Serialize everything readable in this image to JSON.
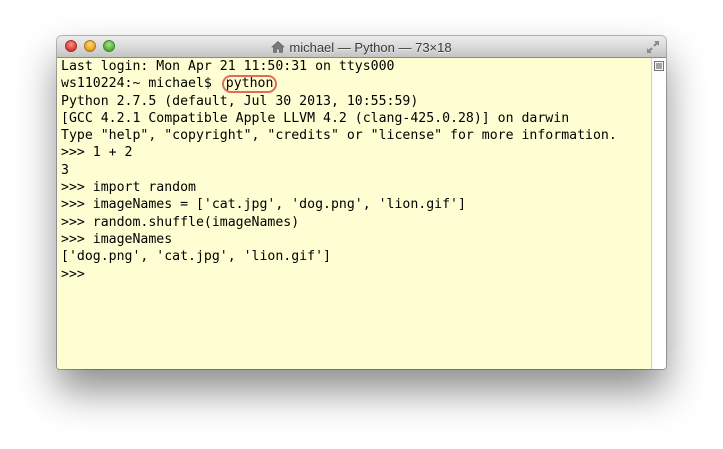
{
  "window": {
    "title": "michael — Python — 73×18",
    "title_icon": "home-icon",
    "traffic_lights": [
      "close",
      "minimize",
      "zoom"
    ],
    "colors": {
      "terminal_background": "#fefed2",
      "text": "#000000",
      "highlight_circle": "#e06b5a"
    }
  },
  "terminal": {
    "lines": [
      "Last login: Mon Apr 21 11:50:31 on ttys000",
      "ws110224:~ michael$ ",
      "Python 2.7.5 (default, Jul 30 2013, 10:55:59)",
      "[GCC 4.2.1 Compatible Apple LLVM 4.2 (clang-425.0.28)] on darwin",
      "Type \"help\", \"copyright\", \"credits\" or \"license\" for more information.",
      ">>> 1 + 2",
      "3",
      ">>> import random",
      ">>> imageNames = ['cat.jpg', 'dog.png', 'lion.gif']",
      ">>> random.shuffle(imageNames)",
      ">>> imageNames",
      "['dog.png', 'cat.jpg', 'lion.gif']",
      ">>> "
    ],
    "highlighted_command": "python"
  },
  "scrollbar": {
    "icon": "scroll-menu-icon"
  }
}
